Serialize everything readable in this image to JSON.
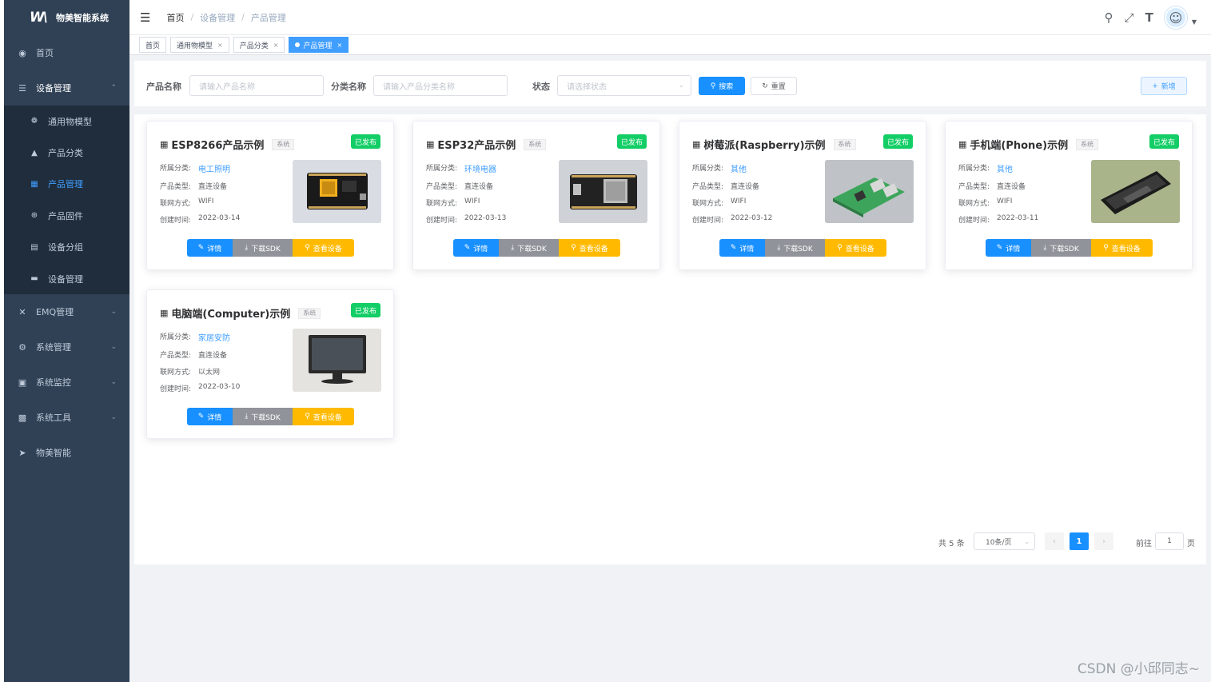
{
  "app": {
    "logo_mark": "W\\",
    "title": "物美智能系统"
  },
  "sidebar": {
    "items": [
      {
        "label": "首页",
        "icon": "dashboard-icon"
      },
      {
        "label": "设备管理",
        "icon": "device-icon",
        "open": true,
        "children": [
          {
            "label": "通用物模型",
            "icon": "model-icon"
          },
          {
            "label": "产品分类",
            "icon": "tree-icon"
          },
          {
            "label": "产品管理",
            "icon": "grid-icon",
            "active": true
          },
          {
            "label": "产品固件",
            "icon": "firmware-icon"
          },
          {
            "label": "设备分组",
            "icon": "group-icon"
          },
          {
            "label": "设备管理",
            "icon": "list-icon"
          }
        ]
      },
      {
        "label": "EMQ管理",
        "icon": "tools-icon"
      },
      {
        "label": "系统管理",
        "icon": "gear-icon"
      },
      {
        "label": "系统监控",
        "icon": "monitor-icon"
      },
      {
        "label": "系统工具",
        "icon": "toolbox-icon"
      },
      {
        "label": "物美智能",
        "icon": "send-icon"
      }
    ]
  },
  "breadcrumb": [
    "首页",
    "设备管理",
    "产品管理"
  ],
  "tags": [
    {
      "label": "首页"
    },
    {
      "label": "通用物模型"
    },
    {
      "label": "产品分类"
    },
    {
      "label": "产品管理",
      "active": true
    }
  ],
  "search": {
    "product_name_label": "产品名称",
    "product_name_placeholder": "请输入产品名称",
    "category_label": "分类名称",
    "category_placeholder": "请输入产品分类名称",
    "status_label": "状态",
    "status_placeholder": "请选择状态",
    "search_btn": "搜索",
    "reset_btn": "重置",
    "add_btn": "新增"
  },
  "labels": {
    "category": "所属分类:",
    "type": "产品类型:",
    "network": "联网方式:",
    "created": "创建时间:",
    "system_tag": "系统",
    "detail_btn": "详情",
    "sdk_btn": "下载SDK",
    "device_btn": "查看设备"
  },
  "products": [
    {
      "name": "ESP8266产品示例",
      "status": "已发布",
      "category": "电工照明",
      "type": "直连设备",
      "network": "WIFI",
      "created": "2022-03-14"
    },
    {
      "name": "ESP32产品示例",
      "status": "已发布",
      "category": "环境电器",
      "type": "直连设备",
      "network": "WIFI",
      "created": "2022-03-13"
    },
    {
      "name": "树莓派(Raspberry)示例",
      "status": "已发布",
      "category": "其他",
      "type": "直连设备",
      "network": "WIFI",
      "created": "2022-03-12"
    },
    {
      "name": "手机端(Phone)示例",
      "status": "已发布",
      "category": "其他",
      "type": "直连设备",
      "network": "WIFI",
      "created": "2022-03-11"
    },
    {
      "name": "电脑端(Computer)示例",
      "status": "已发布",
      "category": "家居安防",
      "type": "直连设备",
      "network": "以太网",
      "created": "2022-03-10"
    }
  ],
  "pagination": {
    "total": "共 5 条",
    "page_size": "10条/页",
    "current_page": "1",
    "goto_label": "前往",
    "goto_value": "1",
    "page_suffix": "页"
  },
  "watermark": "CSDN @小邱同志~",
  "colors": {
    "sidebar_bg": "#304156",
    "primary": "#1890ff",
    "success": "#13ce66",
    "warning": "#ffba00",
    "info": "#909399"
  }
}
